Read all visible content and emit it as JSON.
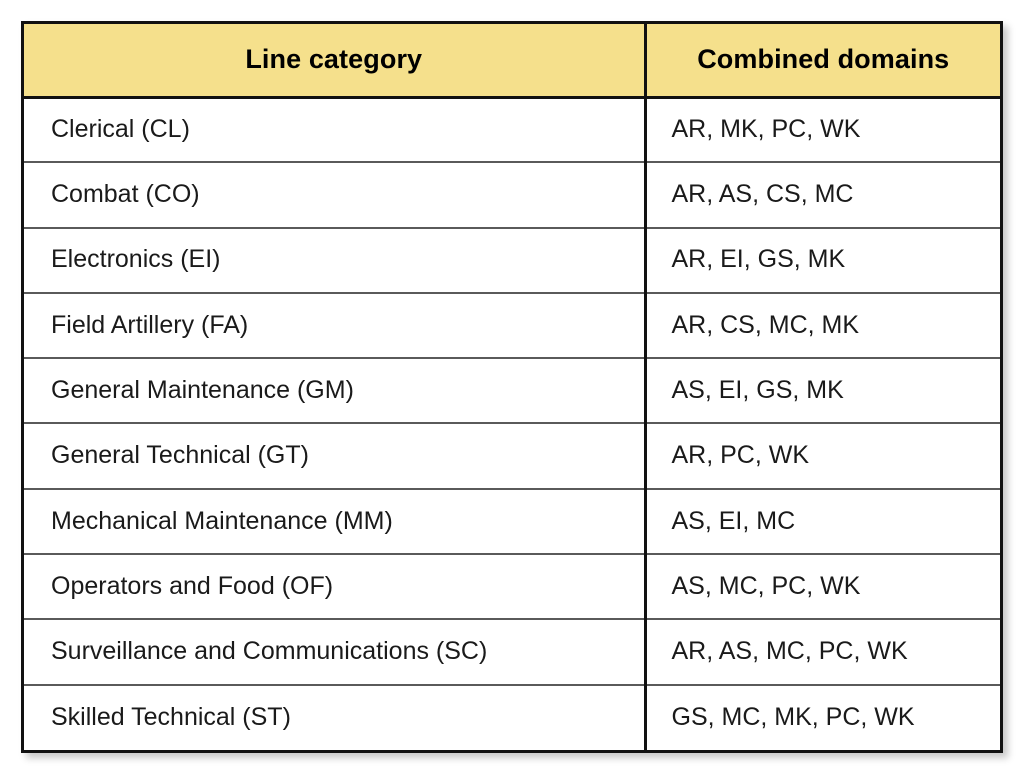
{
  "table": {
    "headers": {
      "category": "Line category",
      "domains": "Combined domains"
    },
    "style": {
      "header_background": "#F5E08C",
      "header_text_color": "#000000",
      "body_background": "#FFFFFF",
      "body_text_color": "#1A1A1A",
      "outer_border_color": "#111111",
      "row_separator_color": "#5A5A5A",
      "page_background": "#FFFFFF"
    },
    "rows": [
      {
        "category": "Clerical (CL)",
        "domains": "AR, MK, PC, WK"
      },
      {
        "category": "Combat (CO)",
        "domains": "AR, AS, CS, MC"
      },
      {
        "category": "Electronics (EI)",
        "domains": "AR, EI, GS, MK"
      },
      {
        "category": "Field Artillery (FA)",
        "domains": "AR, CS, MC, MK"
      },
      {
        "category": "General Maintenance (GM)",
        "domains": "AS, EI, GS, MK"
      },
      {
        "category": "General Technical (GT)",
        "domains": "AR, PC, WK"
      },
      {
        "category": "Mechanical Maintenance (MM)",
        "domains": "AS, EI, MC"
      },
      {
        "category": "Operators and Food (OF)",
        "domains": "AS, MC, PC, WK"
      },
      {
        "category": "Surveillance and Communications (SC)",
        "domains": "AR, AS, MC, PC, WK"
      },
      {
        "category": "Skilled Technical (ST)",
        "domains": "GS, MC, MK, PC, WK"
      }
    ]
  }
}
